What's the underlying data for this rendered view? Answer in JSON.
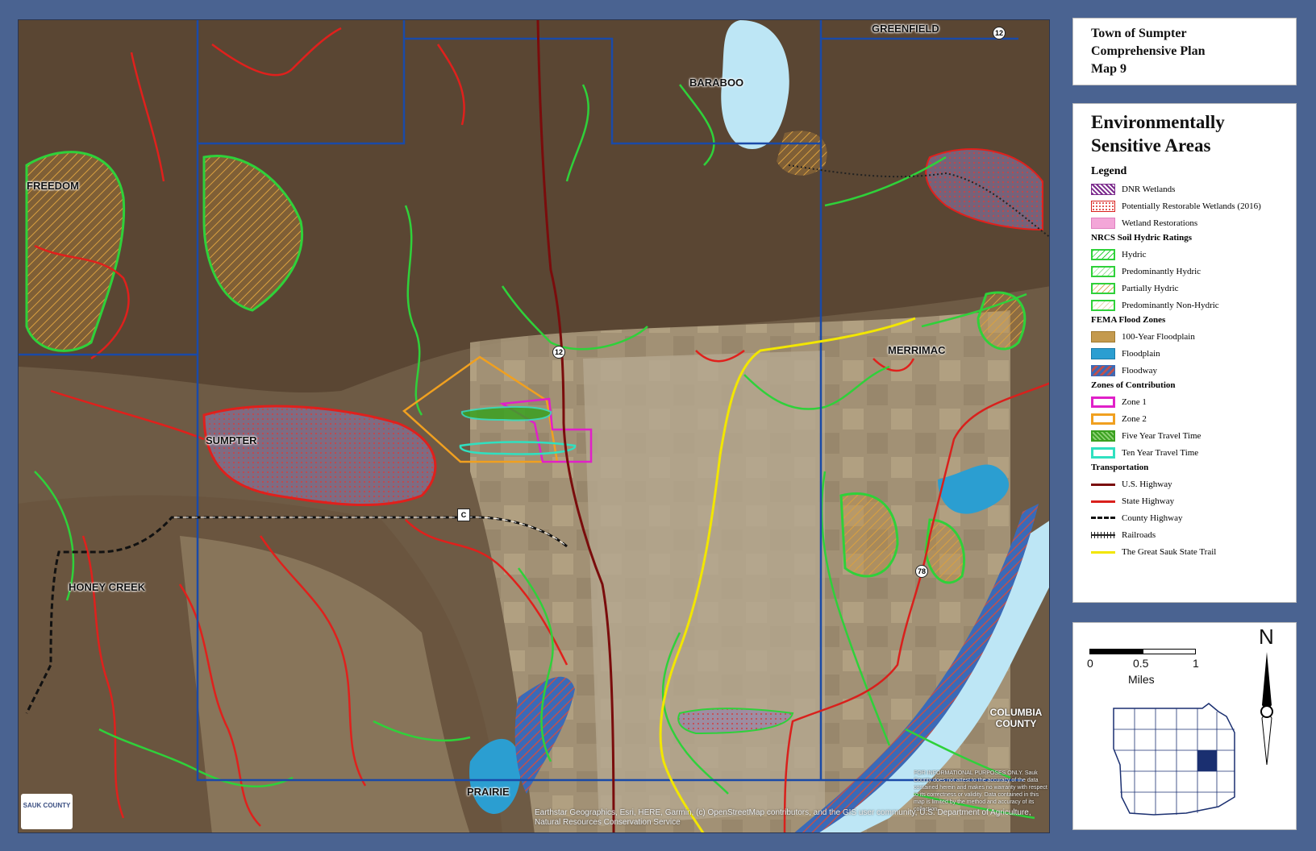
{
  "title": {
    "line1": "Town of Sumpter",
    "line2": "Comprehensive Plan",
    "line3": "Map 9"
  },
  "legend": {
    "heading_line1": "Environmentally",
    "heading_line2": "Sensitive Areas",
    "subheading": "Legend",
    "items_top": [
      {
        "label": "DNR Wetlands",
        "icon": "dnr-wetland-swatch",
        "color": "#7b2a8c"
      },
      {
        "label": "Potentially Restorable Wetlands (2016)",
        "icon": "restorable-wetland-swatch",
        "color": "#d9201c"
      },
      {
        "label": "Wetland Restorations",
        "icon": "wetland-restoration-swatch",
        "color": "#f3a6d8"
      }
    ],
    "groups": {
      "nrcs": "NRCS Soil Hydric Ratings",
      "fema": "FEMA Flood Zones",
      "zones": "Zones of Contribution",
      "transport": "Transportation"
    },
    "nrcs_items": [
      "Hydric",
      "Predominantly Hydric",
      "Partially Hydric",
      "Predominantly Non-Hydric"
    ],
    "fema_items": [
      "100-Year Floodplain",
      "Floodplain",
      "Floodway"
    ],
    "zone_items": [
      "Zone 1",
      "Zone 2",
      "Five Year Travel Time",
      "Ten Year Travel Time"
    ],
    "transport_items": [
      "U.S. Highway",
      "State Highway",
      "County Highway",
      "Railroads",
      "The Great Sauk State Trail"
    ]
  },
  "colors": {
    "us_highway": "#7a0c0c",
    "state_highway": "#d9201c",
    "county_highway": "#111111",
    "trail": "#f2e600",
    "hydric": "#2fd13a",
    "floodplain_100": "#c49a4e",
    "floodplain": "#2b9ed1",
    "zone1": "#e020c8",
    "zone2": "#f0a020",
    "five_year": "#3aa020",
    "ten_year": "#30e0c0",
    "town_line": "#1a4aa8",
    "wetland": "#7b2a8c",
    "restorable": "#e0201c"
  },
  "map": {
    "places": [
      "GREENFIELD",
      "BARABOO",
      "FREEDOM",
      "SUMPTER",
      "MERRIMAC",
      "HONEY CREEK",
      "PRAIRIE"
    ],
    "shields": [
      "12",
      "12",
      "C",
      "78"
    ],
    "county_label_line1": "COLUMBIA",
    "county_label_line2": "COUNTY",
    "logo_text": "SAUK COUNTY",
    "attribution": "Earthstar Geographics, Esri, HERE, Garmin, (c) OpenStreetMap contributors, and the GIS user community, U.S. Department of Agriculture, Natural Resources Conservation Service",
    "disclaimer": "FOR INFORMATIONAL PURPOSES ONLY. Sauk County does not attest to the accuracy of the data contained herein and makes no warranty with respect to its correctness or validity. Data contained in this map is limited by the method and accuracy of its collection."
  },
  "inset": {
    "scale_labels": [
      "0",
      "0.5",
      "1"
    ],
    "scale_unit": "Miles",
    "north_label": "N"
  }
}
